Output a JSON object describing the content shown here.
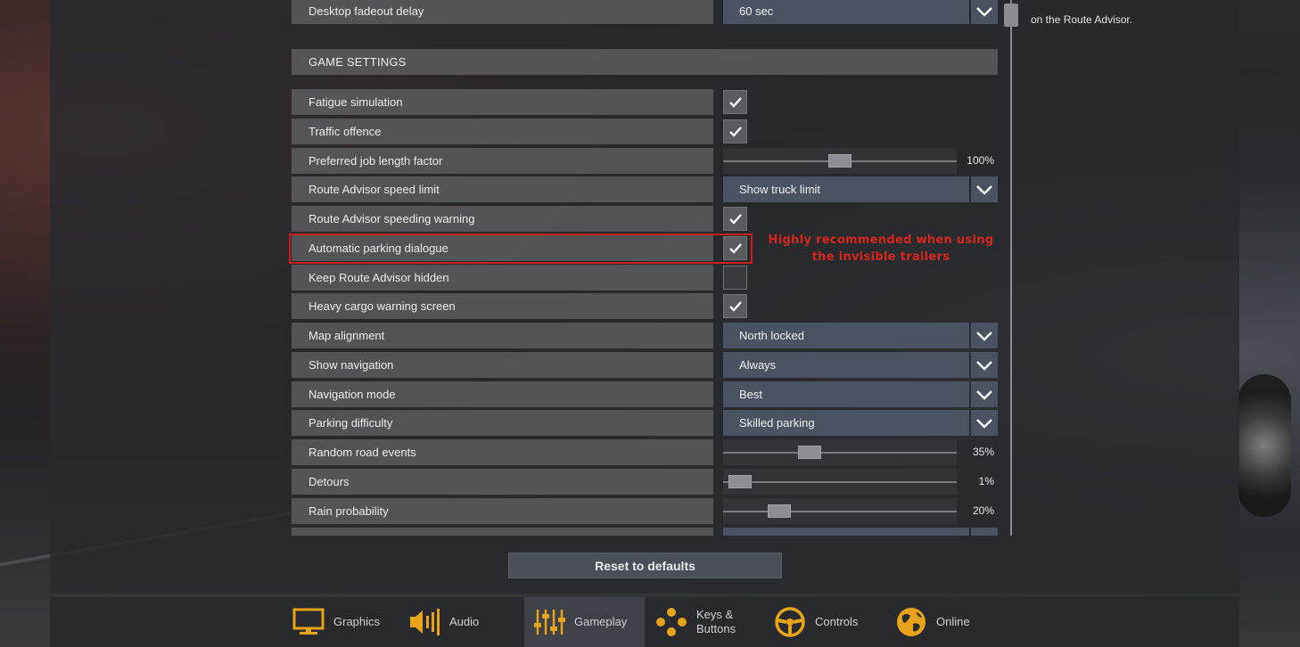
{
  "top_row": {
    "label": "Desktop fadeout delay",
    "value": "60 sec"
  },
  "section": {
    "title": "GAME SETTINGS"
  },
  "rows": [
    {
      "label": "Fatigue simulation",
      "type": "checkbox",
      "checked": true
    },
    {
      "label": "Traffic offence",
      "type": "checkbox",
      "checked": true
    },
    {
      "label": "Preferred job length factor",
      "type": "slider",
      "value_text": "100%",
      "level": 0.5
    },
    {
      "label": "Route Advisor speed limit",
      "type": "dropdown",
      "value": "Show truck limit"
    },
    {
      "label": "Route Advisor speeding warning",
      "type": "checkbox",
      "checked": true
    },
    {
      "label": "Automatic parking dialogue",
      "type": "checkbox",
      "checked": true
    },
    {
      "label": "Keep Route Advisor hidden",
      "type": "checkbox",
      "checked": false
    },
    {
      "label": "Heavy cargo warning screen",
      "type": "checkbox",
      "checked": true
    },
    {
      "label": "Map alignment",
      "type": "dropdown",
      "value": "North locked"
    },
    {
      "label": "Show navigation",
      "type": "dropdown",
      "value": "Always"
    },
    {
      "label": "Navigation mode",
      "type": "dropdown",
      "value": "Best"
    },
    {
      "label": "Parking difficulty",
      "type": "dropdown",
      "value": "Skilled parking"
    },
    {
      "label": "Random road events",
      "type": "slider",
      "value_text": "35%",
      "level": 0.35
    },
    {
      "label": "Detours",
      "type": "slider",
      "value_text": "1%",
      "level": 0.01
    },
    {
      "label": "Rain probability",
      "type": "slider",
      "value_text": "20%",
      "level": 0.2
    }
  ],
  "annotation": {
    "line1": "Highly recommended when using",
    "line2": "the invisible trailers"
  },
  "help": {
    "text": "on the Route Advisor."
  },
  "reset": {
    "label": "Reset to defaults"
  },
  "tabs": [
    {
      "label": "Graphics",
      "icon": "monitor-icon",
      "active": false
    },
    {
      "label": "Audio",
      "icon": "speaker-icon",
      "active": false
    },
    {
      "label": "Gameplay",
      "icon": "sliders-icon",
      "active": true
    },
    {
      "label": "Keys & Buttons",
      "icon": "gamepad-buttons-icon",
      "active": false
    },
    {
      "label": "Controls",
      "icon": "steering-wheel-icon",
      "active": false
    },
    {
      "label": "Online",
      "icon": "globe-icon",
      "active": false
    }
  ],
  "colors": {
    "highlight": "#c8201c",
    "dropdown_bg": "#4a5361",
    "row_bg": "#606064"
  }
}
